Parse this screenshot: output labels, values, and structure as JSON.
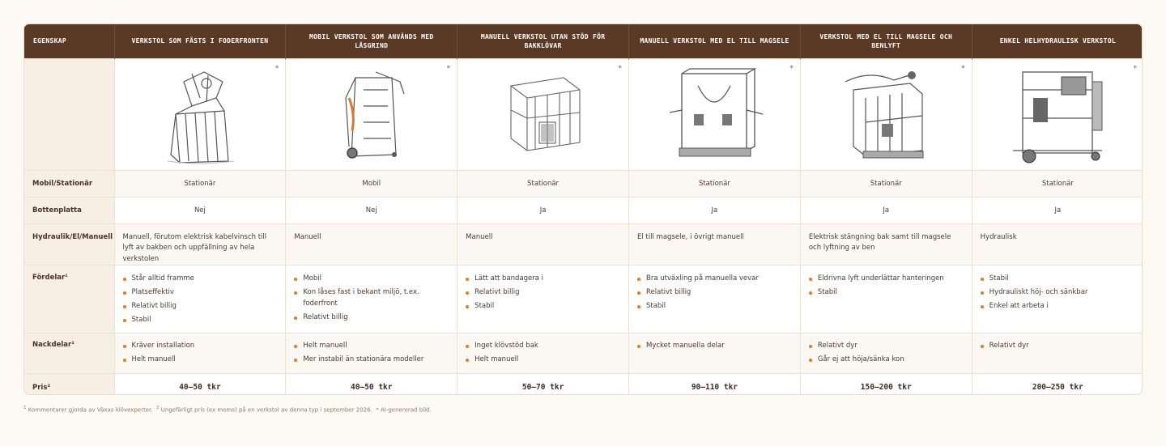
{
  "header": {
    "feature": "EGENSKAP",
    "columns": [
      "VERKSTOL SOM FÄSTS I FODERFRONTEN",
      "MOBIL VERKSTOL SOM ANVÄNDS MED LÅSGRIND",
      "MANUELL VERKSTOL UTAN STÖD FÖR BAKKLÖVAR",
      "MANUELL VERKSTOL MED EL TILL MAGSELE",
      "VERKSTOL MED EL TILL MAGSELE OCH BENLYFT",
      "ENKEL HELHYDRAULISK VERKSTOL"
    ]
  },
  "image_marker": "*",
  "rows": {
    "mobil": {
      "label": "Mobil/Stationär",
      "values": [
        "Stationär",
        "Mobil",
        "Stationär",
        "Stationär",
        "Stationär",
        "Stationär"
      ]
    },
    "botten": {
      "label": "Bottenplatta",
      "values": [
        "Nej",
        "Nej",
        "Ja",
        "Ja",
        "Ja",
        "Ja"
      ]
    },
    "hyd": {
      "label": "Hydraulik/El/Manuell",
      "values": [
        "Manuell, förutom elektrisk kabelvinsch till lyft av bakben och uppfällning av hela verkstolen",
        "Manuell",
        "Manuell",
        "El till magsele, i övrigt manuell",
        "Elektrisk stängning bak samt till magsele och lyftning av ben",
        "Hydraulisk"
      ]
    },
    "pro": {
      "label": "Fördelar¹",
      "values": [
        [
          "Står alltid framme",
          "Platseffektiv",
          "Relativt billig",
          "Stabil"
        ],
        [
          "Mobil",
          "Kon låses fast i bekant miljö, t.ex. foderfront",
          "Relativt billig"
        ],
        [
          "Lätt att bandagera i",
          "Relativt billig",
          "Stabil"
        ],
        [
          "Bra utväxling på manuella vevar",
          "Relativt billig",
          "Stabil"
        ],
        [
          "Eldrivna lyft underlättar hanteringen",
          "Stabil"
        ],
        [
          "Stabil",
          "Hydrauliskt höj- och sänkbar",
          "Enkel att arbeta i"
        ]
      ]
    },
    "con": {
      "label": "Nackdelar¹",
      "values": [
        [
          "Kräver installation",
          "Helt manuell"
        ],
        [
          "Helt manuell",
          "Mer instabil än stationära modeller"
        ],
        [
          "Inget klövstöd bak",
          "Helt manuell"
        ],
        [
          "Mycket manuella delar"
        ],
        [
          "Relativt dyr",
          "Går ej att höja/sänka kon"
        ],
        [
          "Relativt dyr"
        ]
      ]
    },
    "price": {
      "label": "Pris²",
      "values": [
        "40–50 tkr",
        "40–50 tkr",
        "50–70 tkr",
        "90–110 tkr",
        "150–200 tkr",
        "200–250 tkr"
      ]
    }
  },
  "footnotes": {
    "n1_mark": "1",
    "n1_text": "Kommentarer gjorda av Växas klövexperter.",
    "n2_mark": "2",
    "n2_text": "Ungefärligt pris (ex moms) på en verkstol av denna typ i september 2026.",
    "n3_text": "* AI-genererad bild."
  },
  "colors": {
    "header_bg": "#5b3a25",
    "bullet": "#e07a2c",
    "label_bg": "#f7efe4"
  }
}
